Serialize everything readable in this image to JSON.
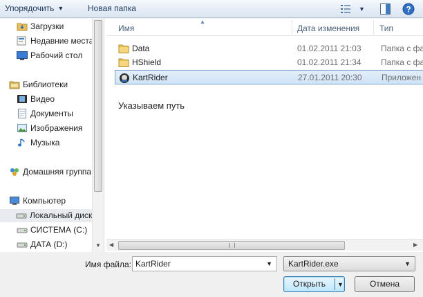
{
  "toolbar": {
    "organize_label": "Упорядочить",
    "new_folder_label": "Новая папка",
    "icons": [
      "view-list-icon",
      "chevron-down-icon",
      "preview-pane-icon",
      "help-icon"
    ]
  },
  "nav": {
    "items": [
      {
        "label": "Загрузки",
        "icon": "downloads-folder-icon"
      },
      {
        "label": "Недавние места",
        "icon": "recent-places-icon"
      },
      {
        "label": "Рабочий стол",
        "icon": "desktop-icon"
      },
      {
        "label": "Библиотеки",
        "icon": "libraries-icon"
      },
      {
        "label": "Видео",
        "icon": "video-library-icon"
      },
      {
        "label": "Документы",
        "icon": "documents-library-icon"
      },
      {
        "label": "Изображения",
        "icon": "pictures-library-icon"
      },
      {
        "label": "Музыка",
        "icon": "music-library-icon"
      },
      {
        "label": "Домашняя группа",
        "icon": "homegroup-icon"
      },
      {
        "label": "Компьютер",
        "icon": "computer-icon"
      },
      {
        "label": "Локальный диск",
        "icon": "drive-icon"
      },
      {
        "label": "СИСТЕМА (C:)",
        "icon": "drive-icon"
      },
      {
        "label": "ДАТА (D:)",
        "icon": "drive-icon"
      }
    ]
  },
  "files": {
    "columns": {
      "name": "Имя",
      "date": "Дата изменения",
      "type": "Тип"
    },
    "rows": [
      {
        "name": "Data",
        "date": "01.02.2011 21:03",
        "type": "Папка с фа",
        "icon": "folder-icon"
      },
      {
        "name": "HShield",
        "date": "01.02.2011 21:34",
        "type": "Папка с фа",
        "icon": "folder-icon"
      },
      {
        "name": "KartRider",
        "date": "27.01.2011 20:30",
        "type": "Приложен",
        "icon": "kartrider-app-icon"
      }
    ],
    "hint": "Указываем путь"
  },
  "bottom": {
    "filename_label": "Имя файла:",
    "filename_value": "KartRider",
    "filetype_value": "KartRider.exe",
    "open_label": "Открыть",
    "cancel_label": "Отмена"
  },
  "colors": {
    "selection": "#cfe3f8",
    "selection_border": "#7da2ce",
    "toolbar_text": "#1e395b"
  }
}
